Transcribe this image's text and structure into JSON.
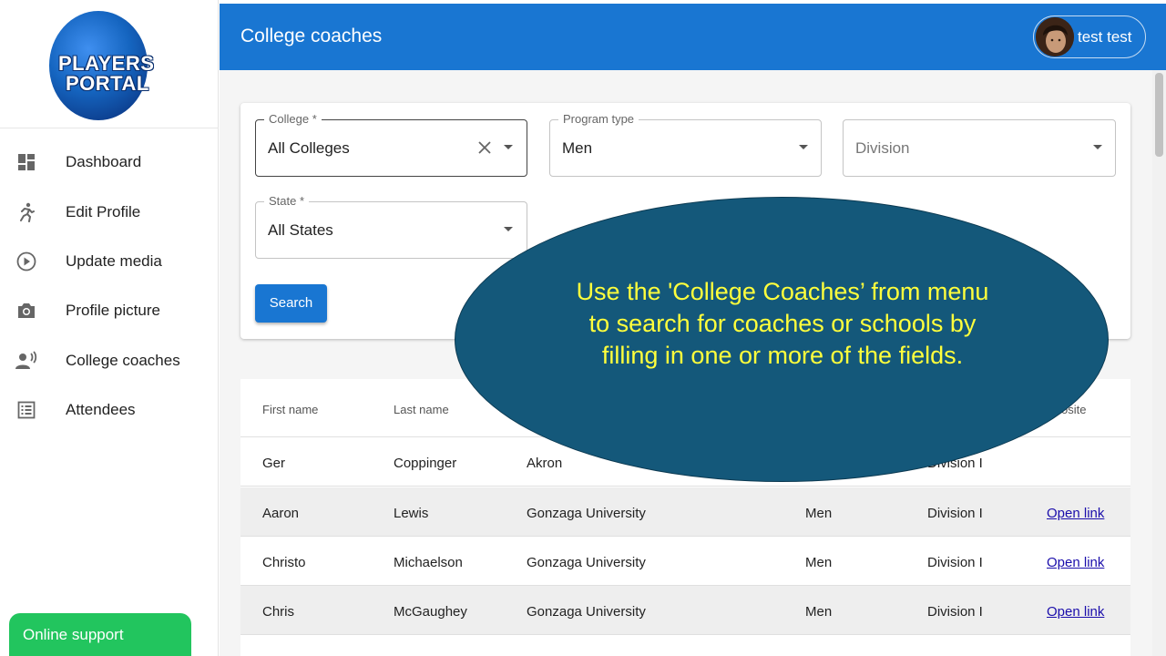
{
  "logo": {
    "line1": "PLAYERS",
    "line2": "PORTAL"
  },
  "sidebar": {
    "items": [
      {
        "label": "Dashboard",
        "icon": "dashboard-icon"
      },
      {
        "label": "Edit Profile",
        "icon": "runner-icon"
      },
      {
        "label": "Update media",
        "icon": "play-circle-icon"
      },
      {
        "label": "Profile picture",
        "icon": "camera-icon"
      },
      {
        "label": "College coaches",
        "icon": "person-voice-icon"
      },
      {
        "label": "Attendees",
        "icon": "list-icon"
      }
    ],
    "support_label": "Online support"
  },
  "header": {
    "title": "College coaches",
    "user_name": "test test"
  },
  "filters": {
    "college": {
      "label": "College *",
      "value": "All Colleges"
    },
    "program_type": {
      "label": "Program type",
      "value": "Men"
    },
    "division": {
      "placeholder": "Division"
    },
    "state": {
      "label": "State *",
      "value": "All States"
    },
    "search_label": "Search"
  },
  "table": {
    "headers": [
      "First name",
      "Last name",
      "osite"
    ],
    "rows": [
      {
        "first": "Ger",
        "last": "Coppinger",
        "college": "Akron",
        "program": "",
        "division": "Division I",
        "website": ""
      },
      {
        "first": "Aaron",
        "last": "Lewis",
        "college": "Gonzaga University",
        "program": "Men",
        "division": "Division I",
        "website": "Open link"
      },
      {
        "first": "Christo",
        "last": "Michaelson",
        "college": "Gonzaga University",
        "program": "Men",
        "division": "Division I",
        "website": "Open link"
      },
      {
        "first": "Chris",
        "last": "McGaughey",
        "college": "Gonzaga University",
        "program": "Men",
        "division": "Division I",
        "website": "Open link"
      }
    ]
  },
  "callout": {
    "text": "Use the 'College Coaches’ from menu to search for coaches or schools by filling in one or more of the fields."
  },
  "colors": {
    "primary": "#1976d2",
    "support": "#22c55e",
    "callout_bg": "#14587a",
    "callout_text": "#ffff3c"
  }
}
